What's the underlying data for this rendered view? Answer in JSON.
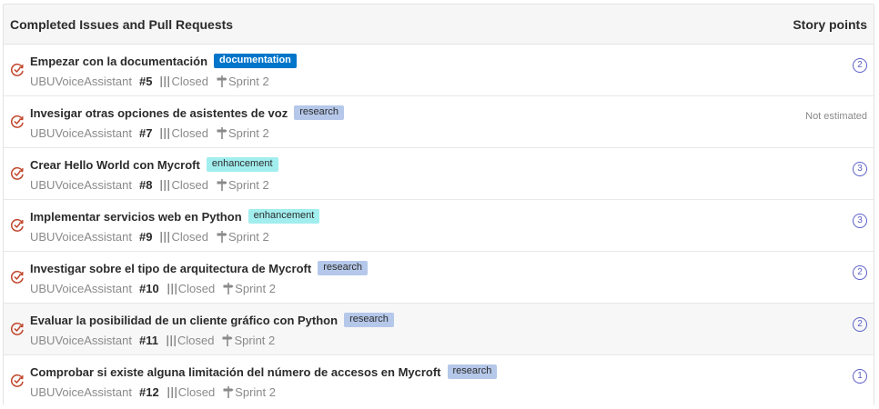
{
  "header": {
    "title": "Completed Issues and Pull Requests",
    "story_points_label": "Story points"
  },
  "colors": {
    "documentation": "#0075ca",
    "research": "#b5c8ea",
    "enhancement": "#a2eeef",
    "closed_icon": "#c0452b",
    "points": "#5b5fc7"
  },
  "issues": [
    {
      "title": "Empezar con la documentación",
      "label": "documentation",
      "repo": "UBUVoiceAssistant",
      "number": "#5",
      "state": "Closed",
      "sprint": "Sprint 2",
      "points": "2"
    },
    {
      "title": "Invesigar otras opciones de asistentes de voz",
      "label": "research",
      "repo": "UBUVoiceAssistant",
      "number": "#7",
      "state": "Closed",
      "sprint": "Sprint 2",
      "points": "Not estimated"
    },
    {
      "title": "Crear Hello World con Mycroft",
      "label": "enhancement",
      "repo": "UBUVoiceAssistant",
      "number": "#8",
      "state": "Closed",
      "sprint": "Sprint 2",
      "points": "3"
    },
    {
      "title": "Implementar servicios web en Python",
      "label": "enhancement",
      "repo": "UBUVoiceAssistant",
      "number": "#9",
      "state": "Closed",
      "sprint": "Sprint 2",
      "points": "3"
    },
    {
      "title": "Investigar sobre el tipo de arquitectura de Mycroft",
      "label": "research",
      "repo": "UBUVoiceAssistant",
      "number": "#10",
      "state": "Closed",
      "sprint": "Sprint 2",
      "points": "2"
    },
    {
      "title": "Evaluar la posibilidad de un cliente gráfico con Python",
      "label": "research",
      "repo": "UBUVoiceAssistant",
      "number": "#11",
      "state": "Closed",
      "sprint": "Sprint 2",
      "points": "2"
    },
    {
      "title": "Comprobar si existe alguna limitación del número de accesos en Mycroft",
      "label": "research",
      "repo": "UBUVoiceAssistant",
      "number": "#12",
      "state": "Closed",
      "sprint": "Sprint 2",
      "points": "1"
    }
  ]
}
